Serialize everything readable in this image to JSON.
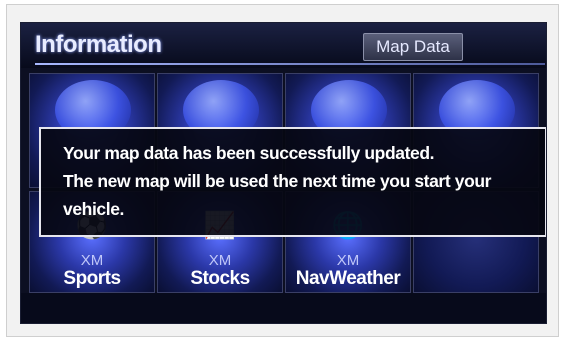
{
  "header": {
    "title": "Information",
    "map_data_button": "Map Data"
  },
  "tiles": [
    {
      "prefix": "",
      "label": "",
      "icon": "globe-icon"
    },
    {
      "prefix": "",
      "label": "",
      "icon": "document-icon"
    },
    {
      "prefix": "",
      "label": "",
      "icon": "weather-icon"
    },
    {
      "prefix": "",
      "label": "",
      "icon": "phone-icon"
    },
    {
      "prefix": "XM",
      "label": "Sports",
      "icon": "sports-icon"
    },
    {
      "prefix": "XM",
      "label": "Stocks",
      "icon": "stocks-chart-icon"
    },
    {
      "prefix": "XM",
      "label": "NavWeather",
      "icon": "globe-weather-icon"
    },
    {
      "prefix": "",
      "label": "",
      "icon": ""
    }
  ],
  "dialog": {
    "line1": "Your map data has been successfully updated.",
    "line2": "The new map will be used the next time you start your",
    "line3": "vehicle."
  },
  "colors": {
    "screen_bg": "#0c0f22",
    "tile_blue": "#3e55e8",
    "dialog_border": "#e6e6ee",
    "text": "#ffffff"
  }
}
